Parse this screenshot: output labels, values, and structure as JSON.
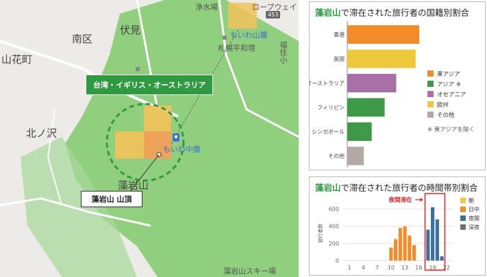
{
  "map": {
    "badge_label": "台湾・イギリス・オーストラリア",
    "callout_label": "藻岩山 山頂",
    "labels": {
      "minami_ku": "南区",
      "fushimi": "伏見",
      "yamahana": "山花町",
      "kitanosawa": "北ノ沢",
      "moiwa_station": "もいわ中腹",
      "moiwa_foot": "もいわ山麓",
      "sapporo_heiwa": "札幌平和塔",
      "moiwa_yama": "藻岩山",
      "ski_area": "藻岩山スキー場",
      "jozuiin": "浄水場",
      "ropeway": "ロープウェイ",
      "fukuzumi": "福住小",
      "road_number": "453"
    }
  },
  "panel1": {
    "title_highlight": "藻岩山",
    "title_rest": "で滞在された旅行者の国籍別割合",
    "footnote": "※ 東アジアを除く"
  },
  "panel2": {
    "title_highlight": "藻岩山",
    "title_rest": "で滞在された旅行者の時間帯別割合",
    "annotation": "夜間滞在"
  },
  "colors": {
    "east_asia": "#f28c28",
    "asia": "#3e9a48",
    "oceania": "#a86fa8",
    "europe": "#f0c83c",
    "other": "#b3aaa6",
    "morning": "#f0c83c",
    "daytime": "#f28c28",
    "night": "#3f6f9e",
    "late_night": "#707070",
    "green": "#2f9a3f",
    "red": "#e02020"
  },
  "chart_data": [
    {
      "type": "bar",
      "orientation": "horizontal",
      "categories": [
        "香港",
        "英国",
        "オーストラリア",
        "フィリピン",
        "シンガポール",
        "その他"
      ],
      "values": [
        100,
        95,
        68,
        52,
        34,
        23
      ],
      "bar_colors": [
        "#f28c28",
        "#f0c83c",
        "#a86fa8",
        "#3e9a48",
        "#3e9a48",
        "#b3aaa6"
      ],
      "legend": [
        {
          "name": "東アジア",
          "color": "#f28c28"
        },
        {
          "name": "アジア ※",
          "color": "#3e9a48"
        },
        {
          "name": "オセアニア",
          "color": "#a86fa8"
        },
        {
          "name": "欧州",
          "color": "#f0c83c"
        },
        {
          "name": "その他",
          "color": "#b3aaa6"
        }
      ],
      "legend_placement": "right",
      "grid": false
    },
    {
      "type": "bar",
      "x": [
        0,
        1,
        2,
        3,
        4,
        5,
        6,
        7,
        8,
        9,
        10,
        11,
        12,
        13,
        14,
        15,
        16,
        17,
        18,
        19,
        20,
        21,
        22,
        23
      ],
      "values": [
        0,
        0,
        0,
        0,
        0,
        0,
        0,
        0,
        0,
        0,
        150,
        250,
        380,
        400,
        290,
        180,
        0,
        0,
        360,
        620,
        480,
        50,
        0,
        0
      ],
      "bar_colors": [
        "#707070",
        "#707070",
        "#707070",
        "#707070",
        "#f0c83c",
        "#f0c83c",
        "#f0c83c",
        "#f0c83c",
        "#f0c83c",
        "#f28c28",
        "#f28c28",
        "#f28c28",
        "#f28c28",
        "#f28c28",
        "#f28c28",
        "#f28c28",
        "#f28c28",
        "#f28c28",
        "#3f6f9e",
        "#3f6f9e",
        "#3f6f9e",
        "#3f6f9e",
        "#707070",
        "#707070"
      ],
      "xticks": [
        "1",
        "4",
        "7",
        "10",
        "13",
        "16",
        "19",
        "22"
      ],
      "xtick_values": [
        1,
        4,
        7,
        10,
        13,
        16,
        19,
        22
      ],
      "yticks": [
        "0",
        "200",
        "400",
        "600"
      ],
      "ylim": [
        0,
        700
      ],
      "ylabel": "旅行者数",
      "highlight_range": [
        18,
        21
      ],
      "legend": [
        {
          "name": "朝",
          "color": "#f0c83c"
        },
        {
          "name": "日中",
          "color": "#f28c28"
        },
        {
          "name": "夜間",
          "color": "#3f6f9e"
        },
        {
          "name": "深夜",
          "color": "#707070"
        }
      ],
      "legend_placement": "right",
      "grid": true
    }
  ]
}
